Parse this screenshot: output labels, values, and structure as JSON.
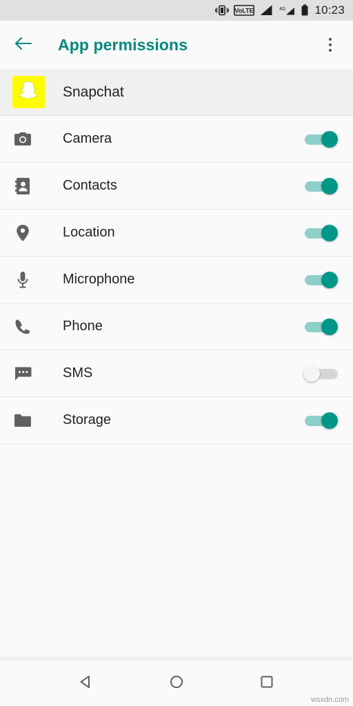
{
  "status_bar": {
    "time": "10:23",
    "icons": [
      "vibrate-icon",
      "volte-icon",
      "signal-icon-1",
      "signal-4g-icon",
      "battery-icon"
    ],
    "volte_label": "VoLTE",
    "network_label": "4G"
  },
  "app_bar": {
    "back_icon": "arrow-back-icon",
    "title": "App permissions",
    "overflow_icon": "more-vert-icon"
  },
  "app_header": {
    "icon": "snapchat-ghost-icon",
    "name": "Snapchat",
    "icon_color": "#fffc00"
  },
  "permissions": [
    {
      "icon": "camera-icon",
      "label": "Camera",
      "enabled": true
    },
    {
      "icon": "contacts-icon",
      "label": "Contacts",
      "enabled": true
    },
    {
      "icon": "location-pin-icon",
      "label": "Location",
      "enabled": true
    },
    {
      "icon": "microphone-icon",
      "label": "Microphone",
      "enabled": true
    },
    {
      "icon": "phone-icon",
      "label": "Phone",
      "enabled": true
    },
    {
      "icon": "sms-icon",
      "label": "SMS",
      "enabled": false
    },
    {
      "icon": "storage-folder-icon",
      "label": "Storage",
      "enabled": true
    }
  ],
  "nav_bar": {
    "back": "triangle-back-icon",
    "home": "circle-home-icon",
    "recents": "square-recents-icon"
  },
  "watermark": "wsxdn.com",
  "theme": {
    "accent": "#00897b",
    "switch_on": "#009688",
    "switch_track_on": "#8fcfc9",
    "switch_off": "#f5f5f5",
    "switch_track_off": "#d6d6d6",
    "icon_gray": "#757575",
    "text_primary": "#212121",
    "background": "#fafafa"
  }
}
